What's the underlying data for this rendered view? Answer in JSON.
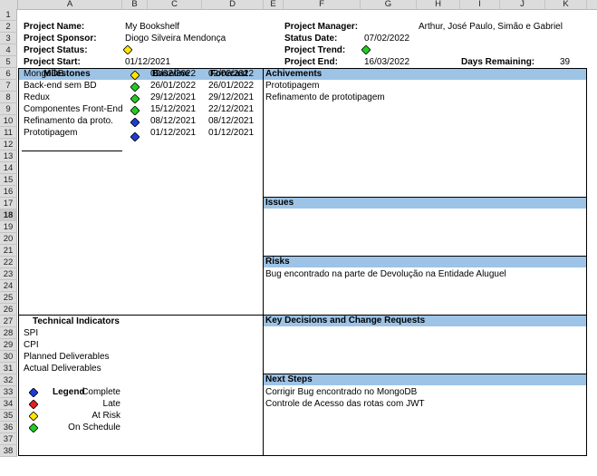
{
  "columns": [
    "A",
    "B",
    "C",
    "D",
    "E",
    "F",
    "G",
    "H",
    "I",
    "J",
    "K"
  ],
  "rows": [
    "1",
    "2",
    "3",
    "4",
    "5",
    "6",
    "7",
    "8",
    "9",
    "10",
    "11",
    "12",
    "13",
    "14",
    "15",
    "16",
    "17",
    "18",
    "19",
    "20",
    "21",
    "22",
    "23",
    "24",
    "25",
    "26",
    "27",
    "28",
    "29",
    "30",
    "31",
    "32",
    "33",
    "34",
    "35",
    "36",
    "37",
    "38"
  ],
  "selected_row": "18",
  "header": {
    "project_name_label": "Project Name:",
    "project_name": "My Bookshelf",
    "project_sponsor_label": "Project Sponsor:",
    "project_sponsor": "Diogo Silveira Mendonça",
    "project_status_label": "Project Status:",
    "project_start_label": "Project Start:",
    "project_start": "01/12/2021",
    "project_manager_label": "Project Manager:",
    "project_manager": "Arthur, José Paulo, Simão e Gabriel",
    "status_date_label": "Status Date:",
    "status_date": "07/02/2022",
    "project_trend_label": "Project Trend:",
    "project_end_label": "Project End:",
    "project_end": "16/03/2022",
    "days_remaining_label": "Days Remaining:",
    "days_remaining": "39"
  },
  "milestones": {
    "title": "Milestones",
    "baseline_label": "Baseline",
    "forecast_label": "Forecast",
    "items": [
      {
        "name": "MongoDB",
        "baseline": "02/02/2022",
        "forecast": "02/02/2022",
        "status": "yellow"
      },
      {
        "name": "Back-end sem BD",
        "baseline": "26/01/2022",
        "forecast": "26/01/2022",
        "status": "green"
      },
      {
        "name": "Redux",
        "baseline": "29/12/2021",
        "forecast": "29/12/2021",
        "status": "green"
      },
      {
        "name": "Componentes Front-End",
        "baseline": "15/12/2021",
        "forecast": "22/12/2021",
        "status": "green"
      },
      {
        "name": "Refinamento da proto.",
        "baseline": "08/12/2021",
        "forecast": "08/12/2021",
        "status": "blue"
      },
      {
        "name": "Prototipagem",
        "baseline": "01/12/2021",
        "forecast": "01/12/2021",
        "status": "blue"
      }
    ]
  },
  "achievements": {
    "title": "Achivements",
    "items": [
      "Prototipagem",
      "Refinamento de prototipagem"
    ]
  },
  "issues": {
    "title": "Issues"
  },
  "risks": {
    "title": "Risks",
    "items": [
      "Bug encontrado na parte de Devolução na Entidade Aluguel"
    ]
  },
  "decisions": {
    "title": "Key Decisions and Change Requests"
  },
  "next_steps": {
    "title": "Next Steps",
    "items": [
      "Corrigir Bug encontrado no MongoDB",
      "Controle de Acesso das rotas com JWT"
    ]
  },
  "technical": {
    "title": "Technical Indicators",
    "items": [
      "SPI",
      "CPI",
      "Planned Deliverables",
      "Actual Deliverables"
    ]
  },
  "legend": {
    "title": "Legend",
    "items": [
      {
        "label": "Complete",
        "color": "blue"
      },
      {
        "label": "Late",
        "color": "red"
      },
      {
        "label": "At Risk",
        "color": "yellow"
      },
      {
        "label": "On Schedule",
        "color": "green"
      }
    ]
  },
  "status_colors": {
    "blue": "#1f3bd6",
    "red": "#e02020",
    "yellow": "#ffe600",
    "green": "#22cc22"
  },
  "project_status_color": "yellow",
  "project_trend_color": "green"
}
